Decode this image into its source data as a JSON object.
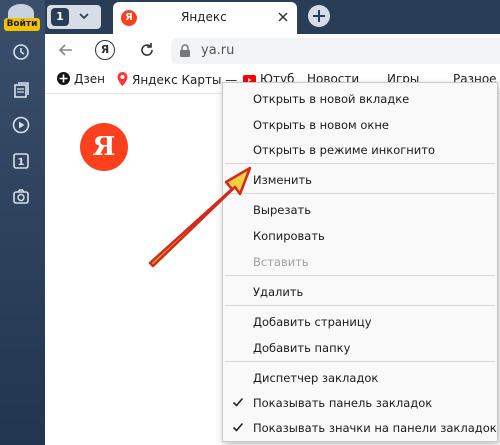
{
  "sidebar": {
    "login_label": "Войти",
    "icons": [
      "clock-icon",
      "collections-icon",
      "play-icon",
      "tab-count-icon",
      "screenshot-icon"
    ],
    "tab_count": "1"
  },
  "tabs": {
    "group_count": "1",
    "active_tab": {
      "title": "Яндекс",
      "favicon": "Я"
    }
  },
  "address_bar": {
    "url": "ya.ru",
    "ya_button": "Я"
  },
  "bookmarks": [
    {
      "label": "Дзен"
    },
    {
      "label": "Яндекс Карты —"
    },
    {
      "label": "Ютуб"
    },
    {
      "label": "Новости"
    },
    {
      "label": "Игры"
    },
    {
      "label": "Разное"
    }
  ],
  "content": {
    "logo": "Я"
  },
  "context_menu": {
    "items": [
      {
        "label": "Открыть в новой вкладке"
      },
      {
        "label": "Открыть в новом окне"
      },
      {
        "label": "Открыть в режиме инкогнито"
      },
      {
        "label": "Изменить"
      },
      {
        "label": "Вырезать"
      },
      {
        "label": "Копировать"
      },
      {
        "label": "Вставить",
        "disabled": true
      },
      {
        "label": "Удалить"
      },
      {
        "label": "Добавить страницу"
      },
      {
        "label": "Добавить папку"
      },
      {
        "label": "Диспетчер закладок"
      },
      {
        "label": "Показывать панель закладок",
        "checked": true
      },
      {
        "label": "Показывать значки на панели закладок",
        "checked": true
      }
    ]
  },
  "colors": {
    "accent": "#fc3f1d",
    "sidebar": "#2a3d57",
    "login": "#f2c200",
    "arrow": "#e8c21a"
  }
}
